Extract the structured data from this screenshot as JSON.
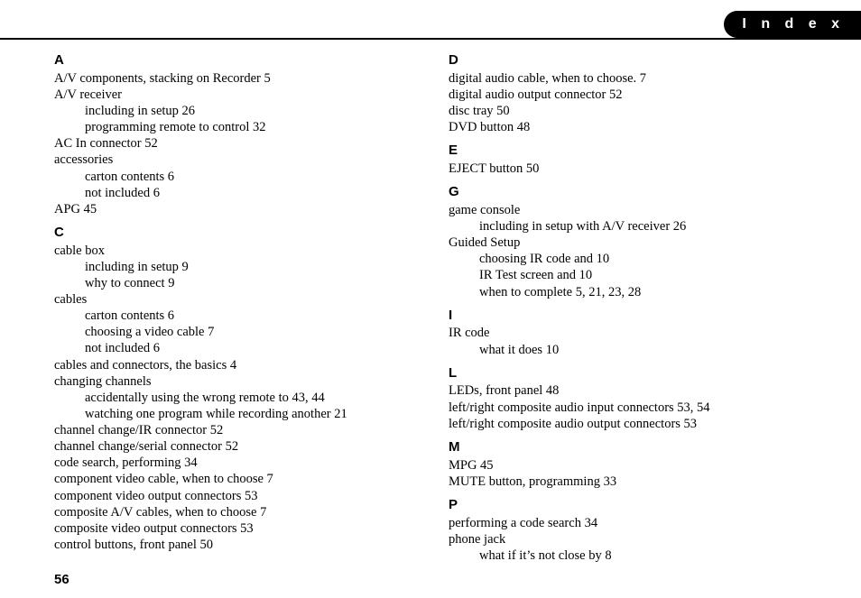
{
  "header": {
    "badge": "I n d e x"
  },
  "pageNumber": "56",
  "columns": [
    {
      "groups": [
        {
          "letter": "A",
          "lines": [
            {
              "t": "entry",
              "text": "A/V components, stacking on Recorder 5"
            },
            {
              "t": "entry",
              "text": "A/V receiver"
            },
            {
              "t": "sub",
              "text": "including in setup 26"
            },
            {
              "t": "sub",
              "text": "programming remote to control 32"
            },
            {
              "t": "entry",
              "text": "AC In connector 52"
            },
            {
              "t": "entry",
              "text": "accessories"
            },
            {
              "t": "sub",
              "text": "carton contents 6"
            },
            {
              "t": "sub",
              "text": "not included 6"
            },
            {
              "t": "entry",
              "text": "APG 45"
            }
          ]
        },
        {
          "letter": "C",
          "lines": [
            {
              "t": "entry",
              "text": "cable box"
            },
            {
              "t": "sub",
              "text": "including in setup 9"
            },
            {
              "t": "sub",
              "text": "why to connect 9"
            },
            {
              "t": "entry",
              "text": "cables"
            },
            {
              "t": "sub",
              "text": "carton contents 6"
            },
            {
              "t": "sub",
              "text": "choosing a video cable 7"
            },
            {
              "t": "sub",
              "text": "not included 6"
            },
            {
              "t": "entry",
              "text": "cables and connectors, the basics 4"
            },
            {
              "t": "entry",
              "text": "changing channels"
            },
            {
              "t": "sub",
              "text": "accidentally using the wrong remote to 43, 44"
            },
            {
              "t": "sub",
              "text": "watching one program while recording another 21"
            },
            {
              "t": "entry",
              "text": "channel change/IR connector 52"
            },
            {
              "t": "entry",
              "text": "channel change/serial connector 52"
            },
            {
              "t": "entry",
              "text": "code search, performing 34"
            },
            {
              "t": "entry",
              "text": "component video cable, when to choose 7"
            },
            {
              "t": "entry",
              "text": "component video output connectors 53"
            },
            {
              "t": "entry",
              "text": "composite A/V cables, when to choose 7"
            },
            {
              "t": "entry",
              "text": "composite video output connectors 53"
            },
            {
              "t": "entry",
              "text": "control buttons, front panel 50"
            }
          ]
        }
      ]
    },
    {
      "groups": [
        {
          "letter": "D",
          "lines": [
            {
              "t": "entry",
              "text": "digital audio cable, when to choose. 7"
            },
            {
              "t": "entry",
              "text": "digital audio output connector 52"
            },
            {
              "t": "entry",
              "text": "disc tray 50"
            },
            {
              "t": "entry",
              "text": "DVD button 48"
            }
          ]
        },
        {
          "letter": "E",
          "lines": [
            {
              "t": "entry",
              "text": "EJECT button 50"
            }
          ]
        },
        {
          "letter": "G",
          "lines": [
            {
              "t": "entry",
              "text": "game console"
            },
            {
              "t": "sub",
              "text": "including in setup with A/V receiver 26"
            },
            {
              "t": "entry",
              "text": "Guided Setup"
            },
            {
              "t": "sub",
              "text": "choosing IR code and 10"
            },
            {
              "t": "sub",
              "text": "IR Test screen and 10"
            },
            {
              "t": "sub",
              "text": "when to complete 5, 21, 23, 28"
            }
          ]
        },
        {
          "letter": "I",
          "lines": [
            {
              "t": "entry",
              "text": "IR code"
            },
            {
              "t": "sub",
              "text": "what it does 10"
            }
          ]
        },
        {
          "letter": "L",
          "lines": [
            {
              "t": "entry",
              "text": "LEDs, front panel 48"
            },
            {
              "t": "entry",
              "text": "left/right composite audio input connectors 53, 54"
            },
            {
              "t": "entry",
              "text": "left/right composite audio output connectors 53"
            }
          ]
        },
        {
          "letter": "M",
          "lines": [
            {
              "t": "entry",
              "text": "MPG 45"
            },
            {
              "t": "entry",
              "text": "MUTE button, programming 33"
            }
          ]
        },
        {
          "letter": "P",
          "lines": [
            {
              "t": "entry",
              "text": "performing a code search 34"
            },
            {
              "t": "entry",
              "text": "phone jack"
            },
            {
              "t": "sub",
              "text": "what if it’s not close by 8"
            }
          ]
        }
      ]
    }
  ]
}
